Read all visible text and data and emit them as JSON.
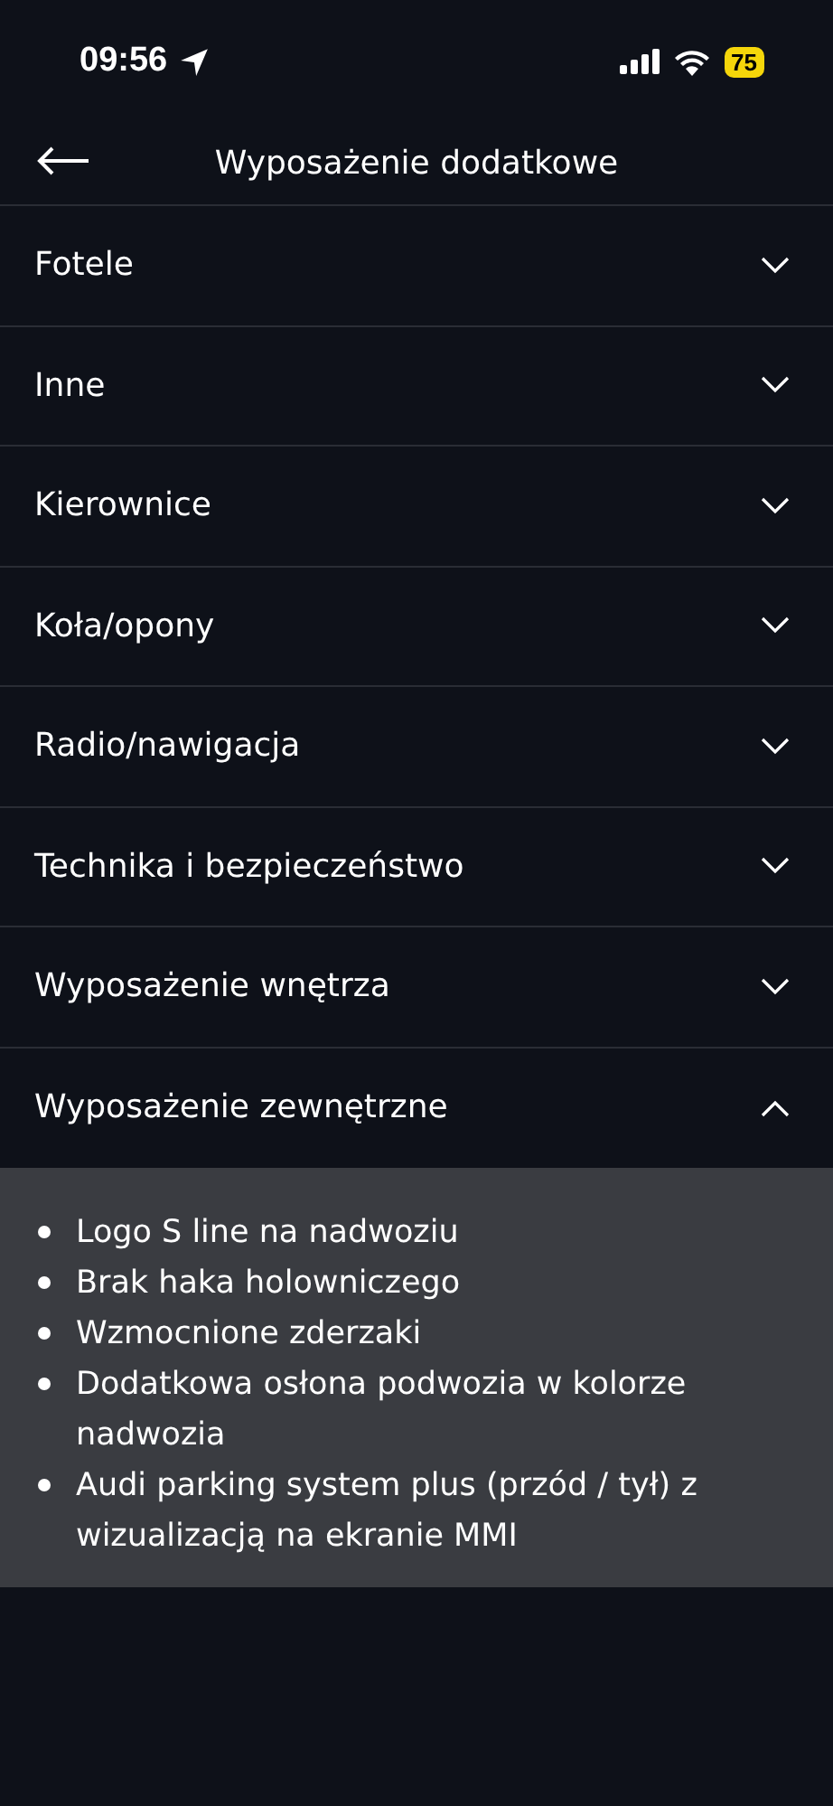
{
  "status_bar": {
    "time": "09:56",
    "battery": "75"
  },
  "header": {
    "title": "Wyposażenie dodatkowe"
  },
  "sections": [
    {
      "label": "Fotele",
      "expanded": false
    },
    {
      "label": "Inne",
      "expanded": false
    },
    {
      "label": "Kierownice",
      "expanded": false
    },
    {
      "label": "Koła/opony",
      "expanded": false
    },
    {
      "label": "Radio/nawigacja",
      "expanded": false
    },
    {
      "label": "Technika i bezpieczeństwo",
      "expanded": false
    },
    {
      "label": "Wyposażenie wnętrza",
      "expanded": false
    },
    {
      "label": "Wyposażenie zewnętrzne",
      "expanded": true,
      "items": [
        "Logo S line na nadwoziu",
        "Brak haka holowniczego",
        "Wzmocnione zderzaki",
        "Dodatkowa osłona podwozia w kolorze nadwozia",
        "Audi parking system plus (przód / tył) z wizualizacją na ekranie MMI"
      ]
    }
  ]
}
